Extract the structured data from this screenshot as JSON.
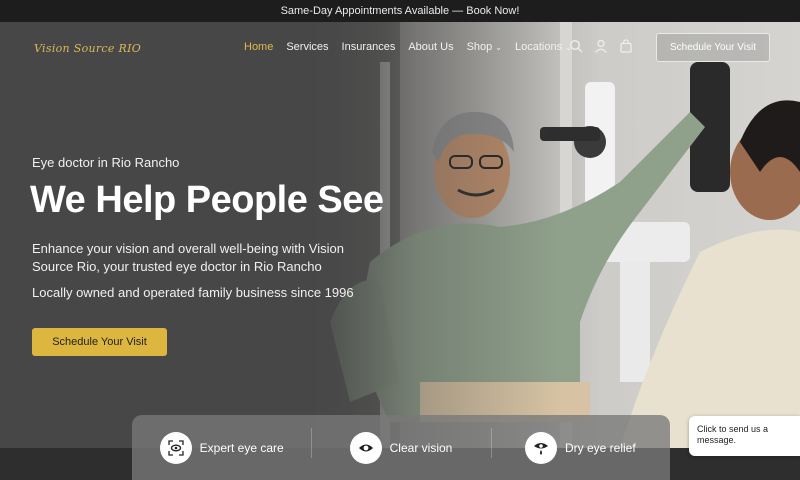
{
  "announcement": "Same-Day Appointments Available — Book Now!",
  "brand": {
    "logo_text": "Vision Source RIO"
  },
  "nav": {
    "items": [
      {
        "label": "Home",
        "active": true,
        "dropdown": false
      },
      {
        "label": "Services",
        "active": false,
        "dropdown": false
      },
      {
        "label": "Insurances",
        "active": false,
        "dropdown": false
      },
      {
        "label": "About Us",
        "active": false,
        "dropdown": false
      },
      {
        "label": "Shop",
        "active": false,
        "dropdown": true
      },
      {
        "label": "Locations",
        "active": false,
        "dropdown": true
      }
    ],
    "icons": [
      "search-icon",
      "account-icon",
      "cart-icon"
    ],
    "schedule_label": "Schedule Your Visit"
  },
  "hero": {
    "eyebrow": "Eye doctor in Rio Rancho",
    "headline": "We Help People See",
    "description": "Enhance your vision and overall well-being with Vision Source Rio, your trusted eye doctor in Rio Rancho",
    "tagline": "Locally owned and operated family business since 1996",
    "cta_label": "Schedule Your Visit"
  },
  "features": [
    {
      "label": "Expert eye care",
      "icon": "eye-scan-icon"
    },
    {
      "label": "Clear vision",
      "icon": "eye-icon"
    },
    {
      "label": "Dry eye relief",
      "icon": "eye-drop-icon"
    }
  ],
  "chat": {
    "text": "Click to send us a message."
  },
  "colors": {
    "accent": "#dcb63e",
    "active_nav": "#e0b94a",
    "logo": "#d8b95a",
    "bar": "#1d1d1d"
  }
}
